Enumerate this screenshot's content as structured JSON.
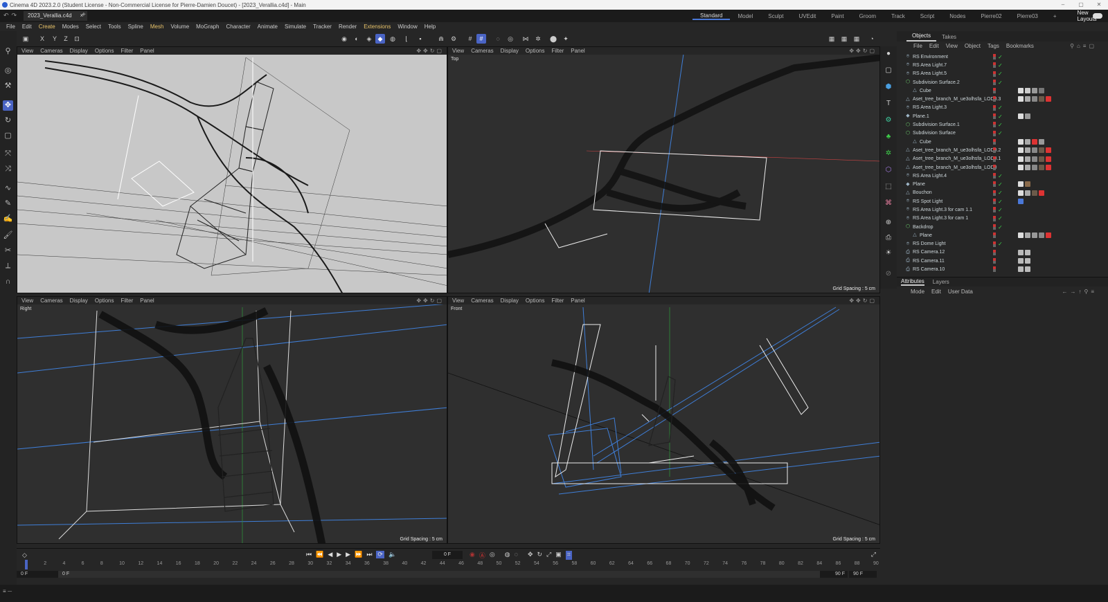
{
  "title_bar": {
    "text": "Cinema 4D 2023.2.0 (Student License - Non-Commercial License for Pierre-Damien Doucet) - [2023_Verallia.c4d] - Main",
    "controls": [
      "–",
      "▢",
      "✕"
    ]
  },
  "doc_tab": {
    "name": "2023_Verallia.c4d",
    "close": "×",
    "new": "+"
  },
  "layouts": {
    "items": [
      "Standard",
      "Model",
      "Sculpt",
      "UVEdit",
      "Paint",
      "Groom",
      "Track",
      "Script",
      "Nodes",
      "Pierre02",
      "Pierre03"
    ],
    "active": "Standard",
    "add": "+",
    "new_layouts": "New Layouts"
  },
  "menu": [
    "File",
    "Edit",
    "Create",
    "Modes",
    "Select",
    "Tools",
    "Spline",
    "Mesh",
    "Volume",
    "MoGraph",
    "Character",
    "Animate",
    "Simulate",
    "Tracker",
    "Render",
    "Extensions",
    "Window",
    "Help"
  ],
  "axes": [
    "X",
    "Y",
    "Z"
  ],
  "viewport_menu": [
    "View",
    "Cameras",
    "Display",
    "Options",
    "Filter",
    "Panel"
  ],
  "viewports": {
    "perspective": {
      "label": "",
      "grid": ""
    },
    "top": {
      "label": "Top",
      "grid": "Grid Spacing : 5 cm"
    },
    "right": {
      "label": "Right",
      "grid": "Grid Spacing : 5 cm"
    },
    "front": {
      "label": "Front",
      "grid": "Grid Spacing : 5 cm"
    }
  },
  "panel_tabs": [
    "Objects",
    "Takes"
  ],
  "panel_menu": [
    "File",
    "Edit",
    "View",
    "Object",
    "Tags",
    "Bookmarks"
  ],
  "objects": [
    {
      "name": "RS Environment",
      "icon": "light",
      "indent": 0,
      "check": true,
      "tags": []
    },
    {
      "name": "RS Area Light.7",
      "icon": "light",
      "indent": 0,
      "check": true,
      "tags": []
    },
    {
      "name": "RS Area Light.5",
      "icon": "light",
      "indent": 0,
      "check": true,
      "tags": []
    },
    {
      "name": "Subdivision Surface.2",
      "icon": "subdiv",
      "indent": 0,
      "check": true,
      "tags": []
    },
    {
      "name": "Cube",
      "icon": "poly",
      "indent": 1,
      "check": false,
      "tags": [
        "#ddd",
        "#ccc",
        "#999",
        "#777"
      ]
    },
    {
      "name": "Aset_tree_branch_M_ue3olhsfa_LOD0.3",
      "icon": "poly",
      "indent": 0,
      "check": false,
      "tags": [
        "#ddd",
        "#aaa",
        "#888",
        "#6b5a4a",
        "#d33"
      ]
    },
    {
      "name": "RS Area Light.3",
      "icon": "light",
      "indent": 0,
      "check": true,
      "tags": []
    },
    {
      "name": "Plane.1",
      "icon": "plane",
      "indent": 0,
      "check": true,
      "tags": [
        "#ddd",
        "#999"
      ]
    },
    {
      "name": "Subdivision Surface.1",
      "icon": "subdiv",
      "indent": 0,
      "check": true,
      "tags": []
    },
    {
      "name": "Subdivision Surface",
      "icon": "subdiv",
      "indent": 0,
      "check": true,
      "tags": []
    },
    {
      "name": "Cube",
      "icon": "poly",
      "indent": 1,
      "check": false,
      "tags": [
        "#ddd",
        "#aaa",
        "#d33",
        "#999"
      ]
    },
    {
      "name": "Aset_tree_branch_M_ue3olhsfa_LOD0.2",
      "icon": "poly",
      "indent": 0,
      "check": false,
      "tags": [
        "#ddd",
        "#aaa",
        "#888",
        "#6b5a4a",
        "#d33"
      ]
    },
    {
      "name": "Aset_tree_branch_M_ue3olhsfa_LOD0.1",
      "icon": "poly",
      "indent": 0,
      "check": false,
      "tags": [
        "#ddd",
        "#aaa",
        "#888",
        "#6b5a4a",
        "#d33"
      ]
    },
    {
      "name": "Aset_tree_branch_M_ue3olhsfa_LOD0",
      "icon": "poly",
      "indent": 0,
      "check": false,
      "tags": [
        "#ddd",
        "#aaa",
        "#888",
        "#6b5a4a",
        "#d33"
      ]
    },
    {
      "name": "RS Area Light.4",
      "icon": "light",
      "indent": 0,
      "check": true,
      "tags": []
    },
    {
      "name": "Plane",
      "icon": "plane",
      "indent": 0,
      "check": true,
      "tags": [
        "#ddd",
        "#8a6a4a"
      ]
    },
    {
      "name": "Bouchon",
      "icon": "poly",
      "indent": 0,
      "check": true,
      "tags": [
        "#ddd",
        "#aaa",
        "#6b5a4a",
        "#d33"
      ]
    },
    {
      "name": "RS Spot Light",
      "icon": "light",
      "indent": 0,
      "check": true,
      "tags": [
        "#4a78d8"
      ]
    },
    {
      "name": "RS Area Light.3 for cam 1.1",
      "icon": "light",
      "indent": 0,
      "check": true,
      "tags": []
    },
    {
      "name": "RS Area Light.3 for cam 1",
      "icon": "light",
      "indent": 0,
      "check": true,
      "tags": []
    },
    {
      "name": "Backdrop",
      "icon": "subdiv",
      "indent": 0,
      "check": true,
      "tags": []
    },
    {
      "name": "Plane",
      "icon": "poly",
      "indent": 1,
      "check": false,
      "tags": [
        "#ddd",
        "#aaa",
        "#999",
        "#888",
        "#d33"
      ]
    },
    {
      "name": "RS Dome Light",
      "icon": "light",
      "indent": 0,
      "check": true,
      "tags": []
    },
    {
      "name": "RS Camera.12",
      "icon": "camera",
      "indent": 0,
      "check": false,
      "tags": [
        "#bbb",
        "#bbb"
      ]
    },
    {
      "name": "RS Camera.11",
      "icon": "camera",
      "indent": 0,
      "check": false,
      "tags": [
        "#bbb",
        "#bbb"
      ]
    },
    {
      "name": "RS Camera.10",
      "icon": "camera",
      "indent": 0,
      "check": false,
      "tags": [
        "#bbb",
        "#bbb"
      ]
    }
  ],
  "attr_tabs": [
    "Attributes",
    "Layers"
  ],
  "attr_menu": [
    "Mode",
    "Edit",
    "User Data"
  ],
  "timeline": {
    "current_frame": "0 F",
    "ticks": [
      "0",
      "2",
      "4",
      "6",
      "8",
      "10",
      "12",
      "14",
      "16",
      "18",
      "20",
      "22",
      "24",
      "26",
      "28",
      "30",
      "32",
      "34",
      "36",
      "38",
      "40",
      "42",
      "44",
      "46",
      "48",
      "50",
      "52",
      "54",
      "56",
      "58",
      "60",
      "62",
      "64",
      "66",
      "68",
      "70",
      "72",
      "74",
      "76",
      "78",
      "80",
      "82",
      "84",
      "86",
      "88",
      "90"
    ],
    "start": "0 F",
    "start2": "0 F",
    "end": "90 F",
    "end2": "90 F"
  },
  "colors": {
    "accent": "#4a64c4",
    "wire_blue": "#3f7fd9",
    "menu_highlight": "#e8c36a",
    "check": "#3ecf4a"
  }
}
